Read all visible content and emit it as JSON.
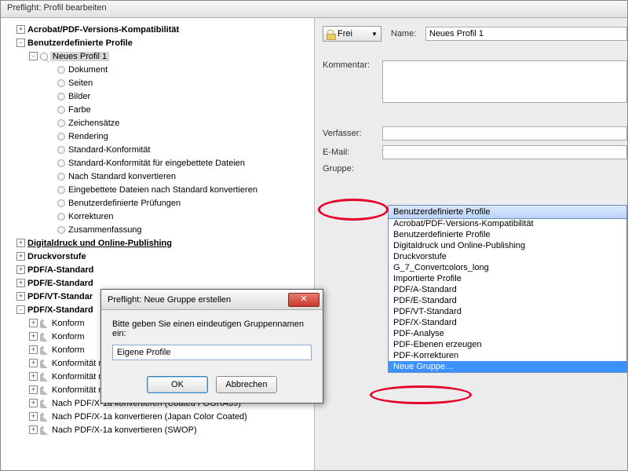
{
  "window": {
    "title": "Preflight: Profil bearbeiten"
  },
  "toolbar": {
    "lock_label": "Frei",
    "name_label": "Name:",
    "name_value": "Neues Profil 1"
  },
  "form": {
    "kommentar_label": "Kommentar:",
    "verfasser_label": "Verfasser:",
    "email_label": "E-Mail:",
    "gruppe_label": "Gruppe:"
  },
  "dropdown": {
    "selected": "Benutzerdefinierte Profile",
    "items": [
      "Acrobat/PDF-Versions-Kompatibilität",
      "Benutzerdefinierte Profile",
      "Digitaldruck und Online-Publishing",
      "Druckvorstufe",
      "G_7_Convertcolors_long",
      "Importierte Profile",
      "PDF/A-Standard",
      "PDF/E-Standard",
      "PDF/VT-Standard",
      "PDF/X-Standard",
      "PDF-Analyse",
      "PDF-Ebenen erzeugen",
      "PDF-Korrekturen",
      "Neue Gruppe…"
    ]
  },
  "tree": {
    "groups": [
      {
        "label": "Acrobat/PDF-Versions-Kompatibilität",
        "exp": "+",
        "bold": true
      },
      {
        "label": "Benutzerdefinierte Profile",
        "exp": "-",
        "bold": true,
        "children": [
          {
            "label": "Neues Profil 1",
            "exp": "-",
            "icon": "mag",
            "selected": true,
            "children": [
              {
                "label": "Dokument"
              },
              {
                "label": "Seiten"
              },
              {
                "label": "Bilder"
              },
              {
                "label": "Farbe"
              },
              {
                "label": "Zeichensätze"
              },
              {
                "label": "Rendering"
              },
              {
                "label": "Standard-Konformität"
              },
              {
                "label": "Standard-Konformität für eingebettete Dateien"
              },
              {
                "label": "Nach Standard konvertieren"
              },
              {
                "label": "Eingebettete Dateien nach Standard konvertieren"
              },
              {
                "label": "Benutzerdefinierte Prüfungen"
              },
              {
                "label": "Korrekturen"
              },
              {
                "label": "Zusammenfassung"
              }
            ]
          }
        ]
      },
      {
        "label": "Digitaldruck und Online-Publishing",
        "exp": "+",
        "bold": true,
        "und": true
      },
      {
        "label": "Druckvorstufe",
        "exp": "+",
        "bold": true
      },
      {
        "label": "PDF/A-Standard",
        "exp": "+",
        "bold": true
      },
      {
        "label": "PDF/E-Standard",
        "exp": "+",
        "bold": true
      },
      {
        "label": "PDF/VT-Standar",
        "exp": "+",
        "bold": true
      },
      {
        "label": "PDF/X-Standard",
        "exp": "-",
        "bold": true,
        "children": [
          {
            "label": "Konform",
            "exp": "+",
            "icon": "wrench"
          },
          {
            "label": "Konform",
            "exp": "+",
            "icon": "wrench"
          },
          {
            "label": "Konform",
            "exp": "+",
            "icon": "wrench"
          },
          {
            "label": "Konformität mit PDF/X-4p prüfen",
            "exp": "+",
            "icon": "wrench"
          },
          {
            "label": "Konformität mit PDF/X-5g prüfen",
            "exp": "+",
            "icon": "wrench"
          },
          {
            "label": "Konformität mit PDF/X-5pg prüfen",
            "exp": "+",
            "icon": "wrench"
          },
          {
            "label": "Nach PDF/X-1a konvertieren (Coated FOGRA39)",
            "exp": "+",
            "icon": "wrench"
          },
          {
            "label": "Nach PDF/X-1a konvertieren (Japan Color Coated)",
            "exp": "+",
            "icon": "wrench"
          },
          {
            "label": "Nach PDF/X-1a konvertieren (SWOP)",
            "exp": "+",
            "icon": "wrench"
          }
        ]
      }
    ]
  },
  "dialog": {
    "title": "Preflight: Neue Gruppe erstellen",
    "prompt": "Bitte geben Sie einen eindeutigen Gruppennamen ein:",
    "value": "Eigene Profile",
    "ok": "OK",
    "cancel": "Abbrechen"
  }
}
